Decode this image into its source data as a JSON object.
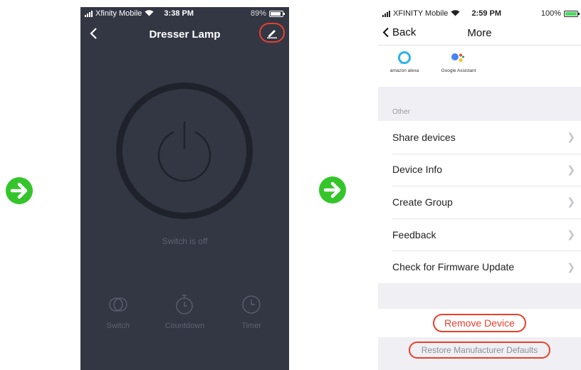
{
  "colors": {
    "arrow": "#34c52a",
    "highlight": "#e8402c",
    "dark_bg": "#333744",
    "light_bg": "#efeff4"
  },
  "screen1": {
    "status": {
      "carrier": "Xfinity Mobile",
      "time": "3:38 PM",
      "battery": "89%",
      "battery_level": 0.89
    },
    "title": "Dresser Lamp",
    "icons": {
      "back": "chevron-left-icon",
      "edit": "pencil-icon",
      "power": "power-icon"
    },
    "status_text": "Switch is off",
    "bottom": [
      {
        "label": "Switch",
        "icon": "switch-toggle-icon"
      },
      {
        "label": "Countdown",
        "icon": "stopwatch-icon"
      },
      {
        "label": "Timer",
        "icon": "clock-icon"
      }
    ]
  },
  "screen2": {
    "status": {
      "carrier": "XFINITY Mobile",
      "time": "2:59 PM",
      "battery": "100%",
      "battery_level": 1.0
    },
    "back_label": "Back",
    "title": "More",
    "assistants": [
      {
        "label": "amazon alexa",
        "icon": "alexa-icon"
      },
      {
        "label": "Google Assistant",
        "icon": "google-assistant-icon"
      }
    ],
    "section_label": "Other",
    "items": [
      {
        "label": "Share devices"
      },
      {
        "label": "Device Info"
      },
      {
        "label": "Create Group"
      },
      {
        "label": "Feedback"
      },
      {
        "label": "Check for Firmware Update"
      }
    ],
    "remove_label": "Remove Device",
    "restore_label": "Restore Manufacturer Defaults"
  }
}
